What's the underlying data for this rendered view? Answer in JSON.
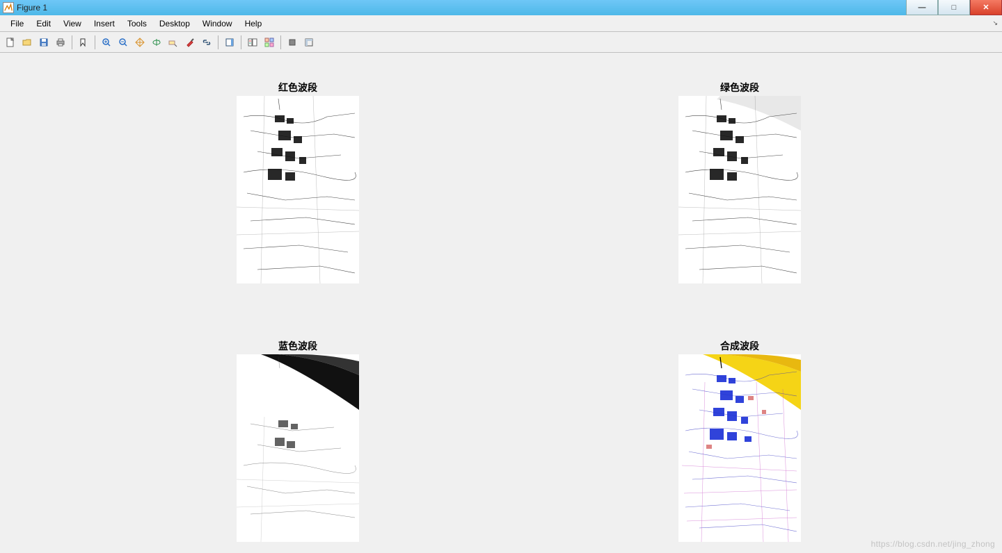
{
  "window": {
    "title": "Figure 1"
  },
  "menu": {
    "items": [
      "File",
      "Edit",
      "View",
      "Insert",
      "Tools",
      "Desktop",
      "Window",
      "Help"
    ]
  },
  "toolbar": {
    "icons": [
      "new",
      "open",
      "save",
      "print",
      "|",
      "pointer",
      "|",
      "zoom-in",
      "zoom-out",
      "pan",
      "rotate",
      "datacursor",
      "brush",
      "link",
      "|",
      "colorbar",
      "|",
      "insert-legend",
      "insert-colorbar",
      "|",
      "hide-tools",
      "show-tools"
    ]
  },
  "subplots": {
    "s1": {
      "title": "红色波段"
    },
    "s2": {
      "title": "绿色波段"
    },
    "s3": {
      "title": "蓝色波段"
    },
    "s4": {
      "title": "合成波段"
    }
  },
  "watermark": "https://blog.csdn.net/jing_zhong"
}
